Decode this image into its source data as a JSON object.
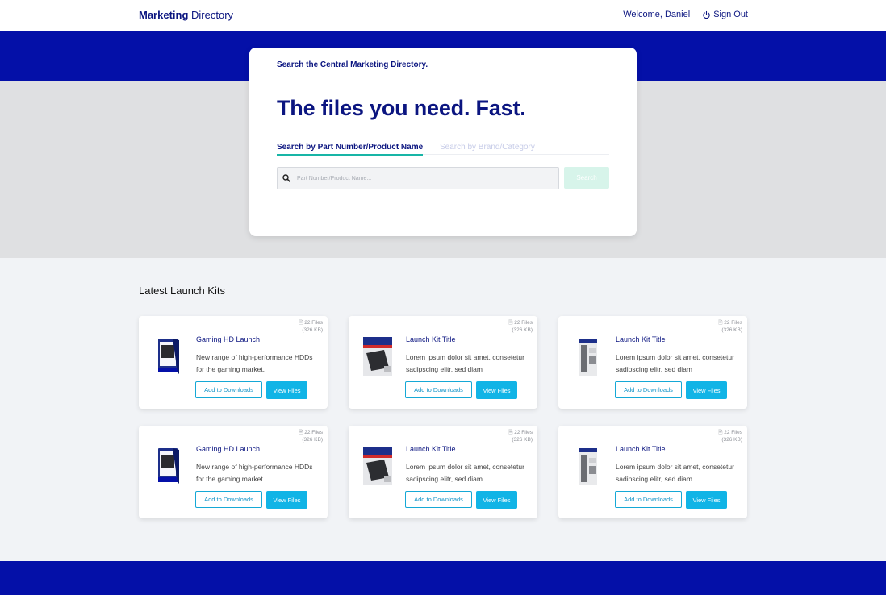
{
  "header": {
    "brand_bold": "Marketing",
    "brand_light": "Directory",
    "welcome": "Welcome, Daniel",
    "sign_out": "Sign Out"
  },
  "search": {
    "kicker": "Search the Central Marketing Directory.",
    "headline": "The files you need. Fast.",
    "tabs": [
      {
        "label": "Search by Part Number/Product Name",
        "active": true
      },
      {
        "label": "Search by Brand/Category",
        "active": false
      }
    ],
    "placeholder": "Part Number/Product Name...",
    "button_label": "Search"
  },
  "kits": {
    "section_title": "Latest Launch Kits",
    "items": [
      {
        "files": "22 Files",
        "size": "(326 KB)",
        "title": "Gaming HD Launch",
        "desc": "New range of high-performance HDDs for the gaming market.",
        "thumb": "hdd-box",
        "add": "Add to Downloads",
        "view": "View Files"
      },
      {
        "files": "22 Files",
        "size": "(326 KB)",
        "title": "Launch Kit Title",
        "desc": "Lorem ipsum dolor sit amet, consetetur sadipscing elitr, sed diam",
        "thumb": "ssd-box",
        "add": "Add to Downloads",
        "view": "View Files"
      },
      {
        "files": "22 Files",
        "size": "(326 KB)",
        "title": "Launch Kit Title",
        "desc": "Lorem ipsum dolor sit amet, consetetur sadipscing elitr, sed diam",
        "thumb": "portable-box",
        "add": "Add to Downloads",
        "view": "View Files"
      },
      {
        "files": "22 Files",
        "size": "(326 KB)",
        "title": "Gaming HD Launch",
        "desc": "New range of high-performance HDDs for the gaming market.",
        "thumb": "hdd-box",
        "add": "Add to Downloads",
        "view": "View Files"
      },
      {
        "files": "22 Files",
        "size": "(326 KB)",
        "title": "Launch Kit Title",
        "desc": "Lorem ipsum dolor sit amet, consetetur sadipscing elitr, sed diam",
        "thumb": "ssd-box",
        "add": "Add to Downloads",
        "view": "View Files"
      },
      {
        "files": "22 Files",
        "size": "(326 KB)",
        "title": "Launch Kit Title",
        "desc": "Lorem ipsum dolor sit amet, consetetur sadipscing elitr, sed diam",
        "thumb": "portable-box",
        "add": "Add to Downloads",
        "view": "View Files"
      }
    ]
  },
  "colors": {
    "brand_blue": "#0410a8",
    "navy_text": "#0b1580",
    "accent_teal": "#18b5a6",
    "button_cyan": "#11b4e6"
  }
}
